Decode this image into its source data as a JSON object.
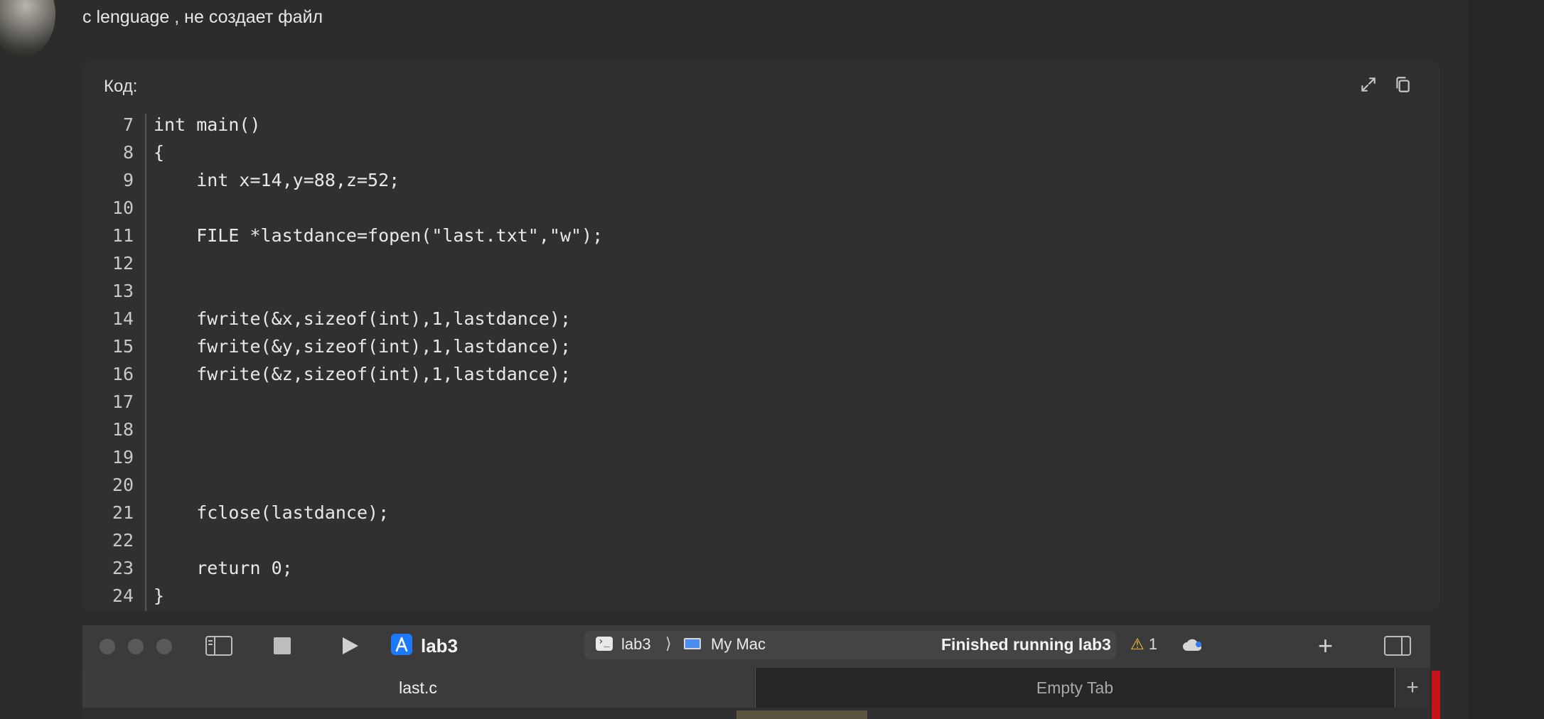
{
  "message": {
    "text": "с lenguage , не создает файл"
  },
  "code_block": {
    "label": "Код:",
    "icons": [
      "expand-icon",
      "copy-icon"
    ],
    "lines": [
      {
        "num": "7",
        "code": "int main()"
      },
      {
        "num": "8",
        "code": "{"
      },
      {
        "num": "9",
        "code": "    int x=14,y=88,z=52;"
      },
      {
        "num": "10",
        "code": ""
      },
      {
        "num": "11",
        "code": "    FILE *lastdance=fopen(\"last.txt\",\"w\");"
      },
      {
        "num": "12",
        "code": ""
      },
      {
        "num": "13",
        "code": ""
      },
      {
        "num": "14",
        "code": "    fwrite(&x,sizeof(int),1,lastdance);"
      },
      {
        "num": "15",
        "code": "    fwrite(&y,sizeof(int),1,lastdance);"
      },
      {
        "num": "16",
        "code": "    fwrite(&z,sizeof(int),1,lastdance);"
      },
      {
        "num": "17",
        "code": ""
      },
      {
        "num": "18",
        "code": ""
      },
      {
        "num": "19",
        "code": ""
      },
      {
        "num": "20",
        "code": ""
      },
      {
        "num": "21",
        "code": "    fclose(lastdance);"
      },
      {
        "num": "22",
        "code": ""
      },
      {
        "num": "23",
        "code": "    return 0;"
      },
      {
        "num": "24",
        "code": "}"
      }
    ]
  },
  "xcode": {
    "scheme": "lab3",
    "destination": {
      "target": "lab3",
      "chevron": "⟩",
      "device": "My Mac"
    },
    "status": "Finished running lab3",
    "warnings": {
      "icon": "⚠",
      "count": "1"
    },
    "plus": "+",
    "tabs": [
      {
        "label": "last.c",
        "active": true
      },
      {
        "label": "Empty Tab",
        "active": false
      }
    ],
    "tab_add": "+"
  }
}
